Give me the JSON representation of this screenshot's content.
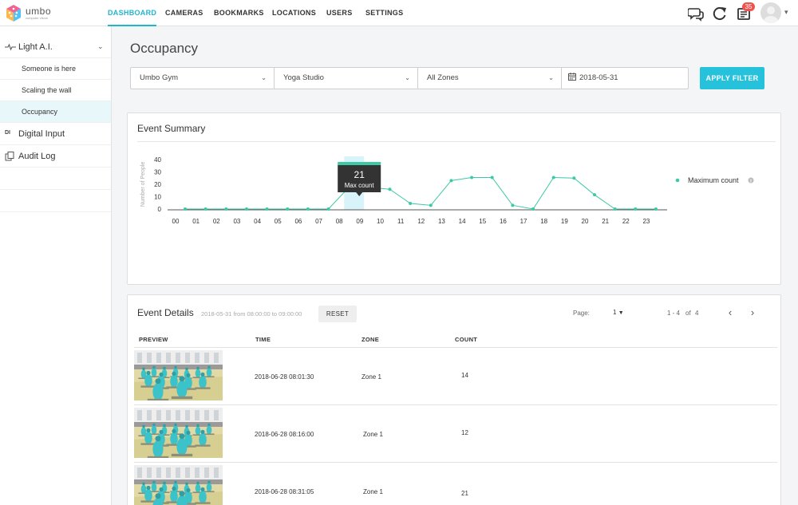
{
  "app": {
    "logo_text": "umbo",
    "logo_sub": "computer vision"
  },
  "nav": {
    "tabs": [
      {
        "label": "DASHBOARD",
        "active": true
      },
      {
        "label": "CAMERAS"
      },
      {
        "label": "BOOKMARKS"
      },
      {
        "label": "LOCATIONS"
      },
      {
        "label": "USERS"
      },
      {
        "label": "SETTINGS"
      }
    ],
    "notification_count": "35",
    "icons": [
      "chat-icon",
      "refresh-icon",
      "notifications-icon",
      "avatar"
    ]
  },
  "sidebar": {
    "groups": [
      {
        "label": "Light A.I.",
        "icon": "pulse-icon",
        "expanded": true,
        "items": [
          {
            "label": "Someone is here"
          },
          {
            "label": "Scaling the wall"
          },
          {
            "label": "Occupancy",
            "active": true
          }
        ]
      },
      {
        "label": "Digital Input",
        "icon_text": "DI"
      },
      {
        "label": "Audit Log",
        "icon": "copy-icon"
      }
    ]
  },
  "page": {
    "title": "Occupancy"
  },
  "filters": {
    "site": "Umbo Gym",
    "area": "Yoga Studio",
    "zone": "All Zones",
    "date": "2018-05-31",
    "apply_label": "APPLY FILTER"
  },
  "summary": {
    "title": "Event Summary",
    "tooltip_value": "21",
    "tooltip_label": "Max count"
  },
  "chart_data": {
    "type": "line",
    "title": "",
    "ylabel": "Number of People",
    "xlabel": "",
    "ylim": [
      0,
      40
    ],
    "yticks": [
      "0",
      "10",
      "20",
      "30",
      "40"
    ],
    "categories": [
      "00",
      "01",
      "02",
      "03",
      "04",
      "05",
      "06",
      "07",
      "08",
      "09",
      "10",
      "11",
      "12",
      "13",
      "14",
      "15",
      "16",
      "17",
      "18",
      "19",
      "20",
      "21",
      "22",
      "23"
    ],
    "series": [
      {
        "name": "Maximum count",
        "values": [
          0,
          0,
          0,
          0,
          0,
          0,
          0,
          0,
          17.5,
          17.5,
          16,
          4.5,
          3,
          23,
          25.5,
          25.5,
          3,
          0,
          25.5,
          25,
          11.5,
          0,
          0,
          0
        ],
        "color": "#3cc9a5"
      }
    ],
    "highlight_category": "08",
    "legend_position": "right",
    "grid": false
  },
  "details": {
    "title": "Event Details",
    "range": "2018-05-31 from 08:00:00 to 09:00:00",
    "reset_label": "RESET",
    "page_label": "Page:",
    "page_value": "1",
    "range_label": "1 - 4",
    "of_label": "of",
    "total": "4",
    "columns": [
      "PREVIEW",
      "TIME",
      "ZONE",
      "COUNT"
    ],
    "rows": [
      {
        "time": "2018-06-28   08:01:30",
        "zone": "Zone 1",
        "count": "14"
      },
      {
        "time": "2018-06-28   08:16:00",
        "zone": "Zone 1",
        "count": "12"
      },
      {
        "time": "2018-06-28   08:31:05",
        "zone": "Zone 1",
        "count": "21"
      }
    ]
  },
  "colors": {
    "accent": "#20b5ce",
    "button": "#26c2dc",
    "series": "#3cc9a5",
    "highlight": "#d8f3fa",
    "badge": "#ef5350"
  }
}
